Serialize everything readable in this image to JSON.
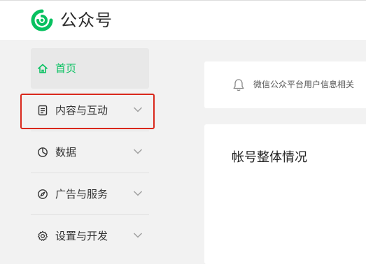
{
  "brand": {
    "title": "公众号",
    "logo_icon": "wechat-official-account-logo",
    "logo_color": "#07c160"
  },
  "sidebar": {
    "items": [
      {
        "label": "首页",
        "icon": "home-icon",
        "active": true
      },
      {
        "label": "内容与互动",
        "icon": "document-icon",
        "expandable": true,
        "highlighted": true
      },
      {
        "label": "数据",
        "icon": "pie-chart-icon",
        "expandable": true
      },
      {
        "label": "广告与服务",
        "icon": "compass-icon",
        "expandable": true
      },
      {
        "label": "设置与开发",
        "icon": "gear-icon",
        "expandable": true
      }
    ]
  },
  "notice": {
    "text": "微信公众平台用户信息相关",
    "icon": "bell-icon"
  },
  "account_overview": {
    "title": "帐号整体情况"
  },
  "colors": {
    "accent": "#07c160",
    "highlight_border": "#d9281c",
    "background": "#f2f2f2"
  }
}
